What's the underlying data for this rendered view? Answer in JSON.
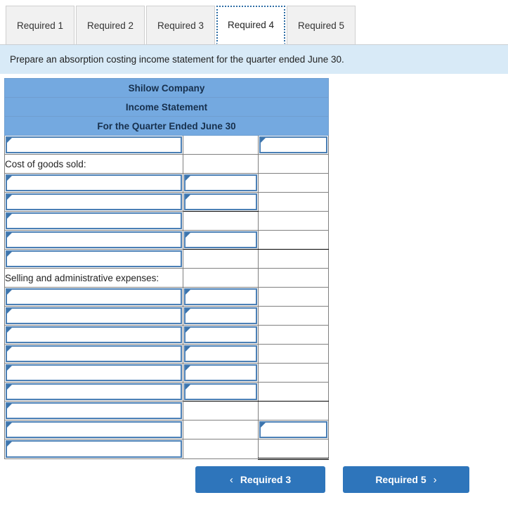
{
  "tabs": [
    {
      "label": "Required 1",
      "active": false
    },
    {
      "label": "Required 2",
      "active": false
    },
    {
      "label": "Required 3",
      "active": false
    },
    {
      "label": "Required 4",
      "active": true
    },
    {
      "label": "Required 5",
      "active": false
    }
  ],
  "instruction": "Prepare an absorption costing income statement for the quarter ended June 30.",
  "sheet": {
    "headers": [
      "Shilow Company",
      "Income Statement",
      "For the Quarter Ended June 30"
    ],
    "rows": [
      {
        "label": "",
        "a": "input",
        "b": "blank",
        "c": "input"
      },
      {
        "label": "Cost of goods sold:",
        "a": "label",
        "b": "blank",
        "c": "blank"
      },
      {
        "label": "",
        "a": "input",
        "b": "input",
        "c": "blank"
      },
      {
        "label": "",
        "a": "input",
        "b": "input-ul",
        "c": "blank"
      },
      {
        "label": "",
        "a": "input",
        "b": "blank",
        "c": "blank"
      },
      {
        "label": "",
        "a": "input",
        "b": "input-ul",
        "c": "underline"
      },
      {
        "label": "",
        "a": "input",
        "b": "blank",
        "c": "blank"
      },
      {
        "label": "Selling and administrative expenses:",
        "a": "label",
        "b": "blank",
        "c": "blank"
      },
      {
        "label": "",
        "a": "input",
        "b": "input",
        "c": "blank"
      },
      {
        "label": "",
        "a": "input",
        "b": "input",
        "c": "blank"
      },
      {
        "label": "",
        "a": "input",
        "b": "input",
        "c": "blank"
      },
      {
        "label": "",
        "a": "input",
        "b": "input",
        "c": "blank"
      },
      {
        "label": "",
        "a": "input",
        "b": "input",
        "c": "blank"
      },
      {
        "label": "",
        "a": "input",
        "b": "input-ul",
        "c": "underline"
      },
      {
        "label": "",
        "a": "input",
        "b": "blank",
        "c": "blank"
      },
      {
        "label": "",
        "a": "input",
        "b": "blank",
        "c": "input"
      },
      {
        "label": "",
        "a": "input",
        "b": "blank",
        "c": "double"
      }
    ]
  },
  "nav": {
    "prev_label": "Required 3",
    "next_label": "Required 5",
    "prev_icon": "chevron-left-icon",
    "next_icon": "chevron-right-icon",
    "prev_chevron": "‹",
    "next_chevron": "›"
  },
  "colors": {
    "header_blue": "#74a9e0",
    "banner_blue": "#d8eaf7",
    "button_blue": "#2e75bb",
    "input_border": "#4a7fb5"
  }
}
